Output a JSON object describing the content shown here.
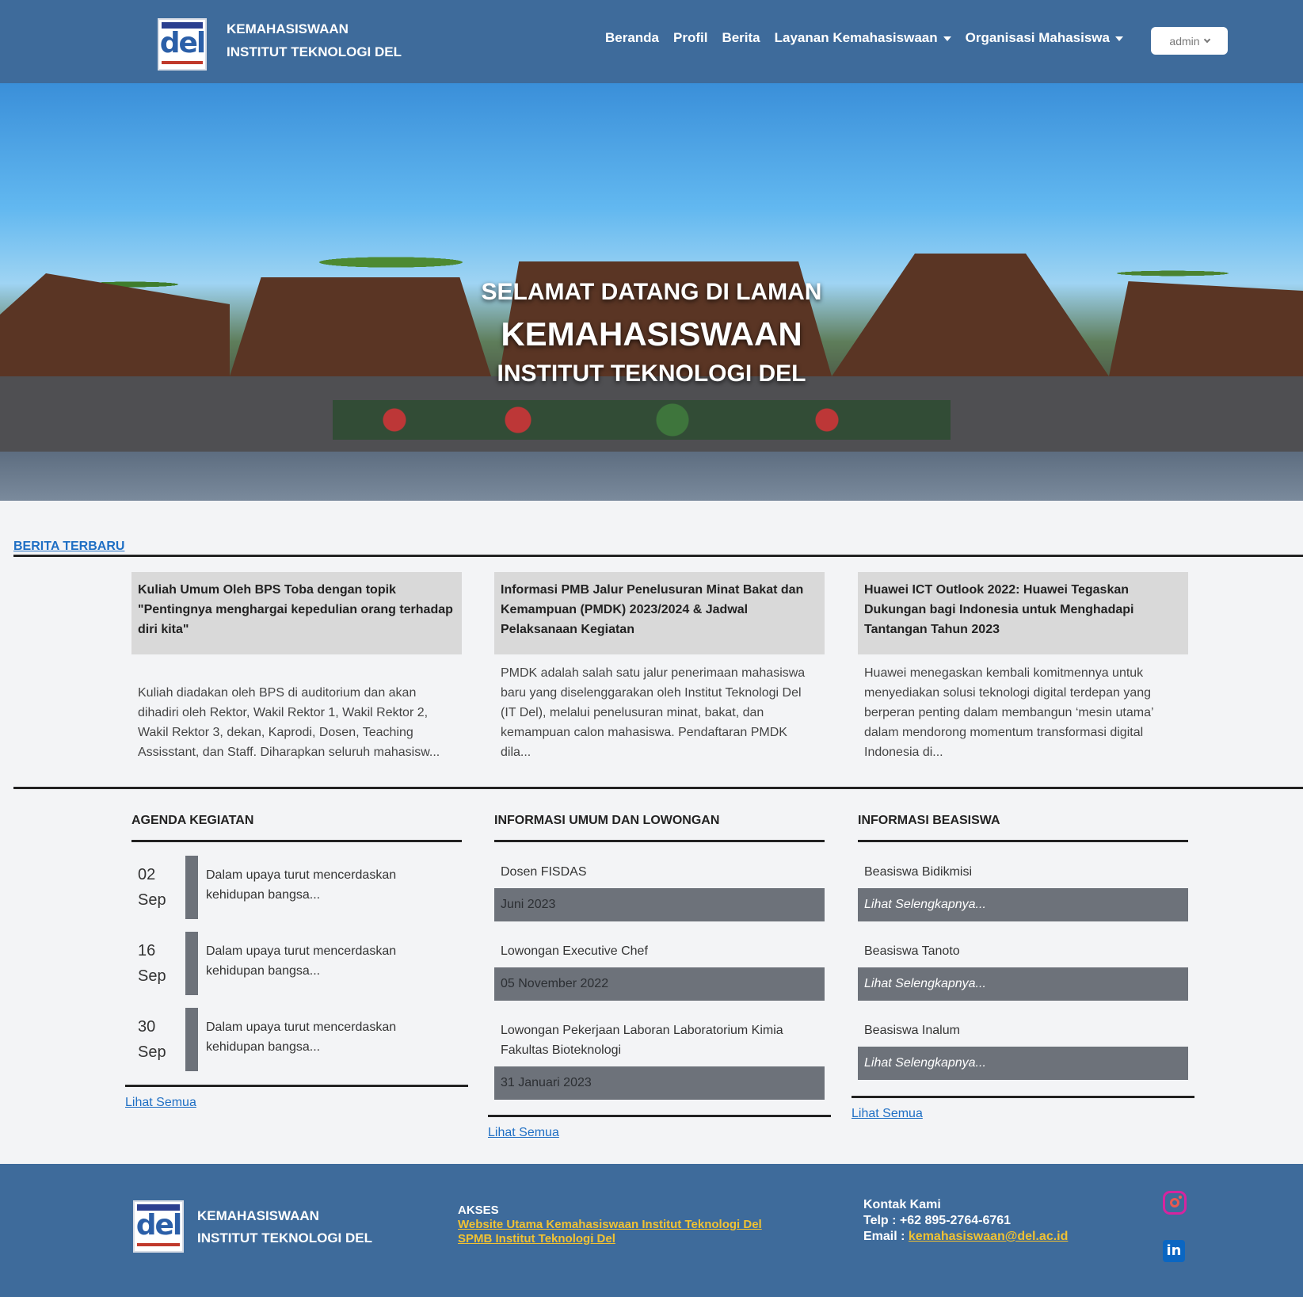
{
  "brand": {
    "line1": "KEMAHASISWAAN",
    "line2": "INSTITUT TEKNOLOGI DEL",
    "logo_text": "del"
  },
  "nav": {
    "items": [
      {
        "label": "Beranda"
      },
      {
        "label": "Profil"
      },
      {
        "label": "Berita"
      },
      {
        "label": "Layanan Kemahasiswaan"
      },
      {
        "label": "Organisasi Mahasiswa"
      }
    ],
    "user_label": "admin"
  },
  "hero": {
    "line1": "SELAMAT DATANG DI LAMAN",
    "line2": "KEMAHASISWAAN",
    "line3": "INSTITUT TEKNOLOGI DEL"
  },
  "berita": {
    "heading": "BERITA TERBARU",
    "cards": [
      {
        "title": "Kuliah Umum Oleh BPS Toba dengan topik \"Pentingnya menghargai kepedulian orang terhadap diri kita\"",
        "excerpt": "Kuliah diadakan oleh BPS di auditorium dan akan dihadiri oleh Rektor, Wakil Rektor 1, Wakil Rektor 2, Wakil Rektor 3, dekan, Kaprodi, Dosen, Teaching Assisstant, dan Staff. Diharapkan seluruh mahasisw..."
      },
      {
        "title": "Informasi PMB Jalur Penelusuran Minat Bakat dan Kemampuan (PMDK) 2023/2024 & Jadwal Pelaksanaan Kegiatan",
        "excerpt": "PMDK adalah salah satu jalur penerimaan mahasiswa baru yang diselenggarakan oleh Institut Teknologi Del (IT Del), melalui penelusuran minat, bakat, dan kemampuan calon mahasiswa. Pendaftaran PMDK dila..."
      },
      {
        "title": "Huawei ICT Outlook 2022: Huawei Tegaskan Dukungan bagi Indonesia untuk Menghadapi Tantangan Tahun 2023",
        "excerpt": "Huawei menegaskan kembali komitmennya untuk menyediakan solusi teknologi digital terdepan yang berperan penting dalam membangun ‘mesin utama’ dalam mendorong momentum transformasi digital Indonesia di..."
      }
    ]
  },
  "agenda": {
    "heading": "AGENDA KEGIATAN",
    "items": [
      {
        "day": "02",
        "month": "Sep",
        "text": "Dalam upaya turut mencerdaskan kehidupan bangsa..."
      },
      {
        "day": "16",
        "month": "Sep",
        "text": "Dalam upaya turut mencerdaskan kehidupan bangsa..."
      },
      {
        "day": "30",
        "month": "Sep",
        "text": "Dalam upaya turut mencerdaskan kehidupan bangsa..."
      }
    ],
    "see_all": "Lihat Semua"
  },
  "informasi": {
    "heading": "INFORMASI UMUM DAN LOWONGAN",
    "items": [
      {
        "title": "Dosen FISDAS",
        "date": "Juni 2023"
      },
      {
        "title": "Lowongan Executive Chef",
        "date": "05 November 2022"
      },
      {
        "title": "Lowongan Pekerjaan Laboran Laboratorium Kimia Fakultas Bioteknologi",
        "date": "31 Januari 2023"
      }
    ],
    "see_all": "Lihat Semua"
  },
  "beasiswa": {
    "heading": "INFORMASI BEASISWA",
    "items": [
      {
        "title": "Beasiswa Bidikmisi",
        "link": "Lihat Selengkapnya..."
      },
      {
        "title": "Beasiswa Tanoto",
        "link": "Lihat Selengkapnya..."
      },
      {
        "title": "Beasiswa Inalum",
        "link": "Lihat Selengkapnya..."
      }
    ],
    "see_all": "Lihat Semua"
  },
  "footer": {
    "brand_line1": "KEMAHASISWAAN",
    "brand_line2": "INSTITUT TEKNOLOGI DEL",
    "logo_text": "del",
    "akses_heading": "AKSES",
    "akses_links": [
      "Website Utama Kemahasiswaan Institut Teknologi Del",
      "SPMB Institut Teknologi Del"
    ],
    "kontak_heading": "Kontak Kami",
    "telp_label": "Telp : ",
    "telp": "+62 895-2764-6761",
    "email_label": "Email : ",
    "email": "kemahasiswaan@del.ac.id",
    "linkedin_text": "in"
  },
  "colors": {
    "navbar": "#3e6b9b",
    "accent_link": "#1f6fc4",
    "footer_link": "#f1c232",
    "bar": "#6d727a"
  }
}
